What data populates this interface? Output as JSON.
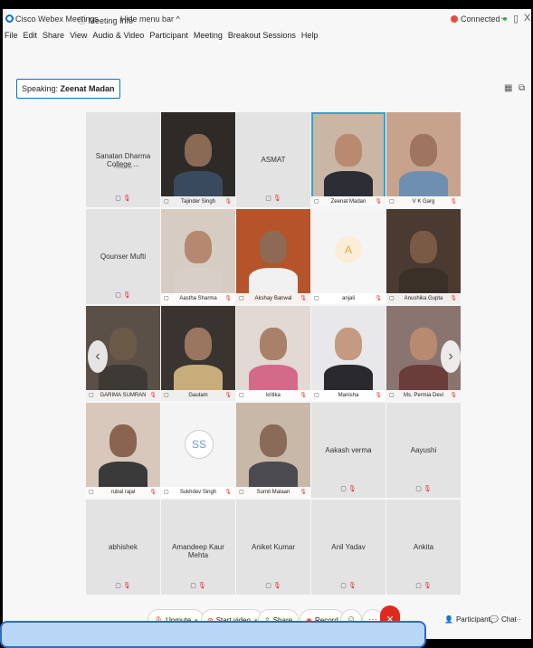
{
  "titlebar": {
    "app_name": "Cisco Webex Meetings",
    "meeting_info": "Meeting Info",
    "hide_menu": "Hide menu bar ^",
    "status": "Connected",
    "minimize": "–",
    "restore": "▯",
    "close": "X"
  },
  "menu": [
    "File",
    "Edit",
    "Share",
    "View",
    "Audio & Video",
    "Participant",
    "Meeting",
    "Breakout Sessions",
    "Help"
  ],
  "speaking": {
    "label": "Speaking:",
    "name": "Zeenat Madan"
  },
  "participants": [
    {
      "name": "Sanatan Dharma College ...",
      "sub": "Host, me",
      "type": "name"
    },
    {
      "name": "Tajinder Singh",
      "type": "video",
      "skin": "#8a6a55",
      "shirt": "#3a4a5e",
      "bg": "#2e2a28"
    },
    {
      "name": "ASMAT",
      "type": "name"
    },
    {
      "name": "Zeenat Madan",
      "type": "video",
      "skin": "#b98a70",
      "shirt": "#2d2d36",
      "bg": "#c9b6a4",
      "active": true
    },
    {
      "name": "V K Garg",
      "type": "video",
      "skin": "#a07560",
      "shirt": "#6f8fb0",
      "bg": "#c7a38e"
    },
    {
      "name": "Qounser Mufti",
      "type": "name"
    },
    {
      "name": "Aastha Sharma",
      "type": "video",
      "skin": "#b58870",
      "shirt": "#d8d0c8",
      "bg": "#d6ccc2"
    },
    {
      "name": "Akshay Banwal",
      "type": "video",
      "skin": "#8e6a55",
      "shirt": "#f0f0f0",
      "bg": "#b5532b"
    },
    {
      "name": "anjali",
      "type": "avatar",
      "initial": "A",
      "style": "a"
    },
    {
      "name": "Anushika Gupta",
      "type": "video",
      "skin": "#7a5a44",
      "shirt": "#3b3028",
      "bg": "#4a3a30"
    },
    {
      "name": "GARIMA SUMRAN",
      "type": "video",
      "skin": "#6b5a48",
      "shirt": "#3d3a36",
      "bg": "#5a5048"
    },
    {
      "name": "Gautam",
      "type": "video",
      "skin": "#9a7560",
      "shirt": "#c7ad7a",
      "bg": "#3a3430"
    },
    {
      "name": "kritika",
      "type": "video",
      "skin": "#a98068",
      "shirt": "#d46a8a",
      "bg": "#e2d8d4"
    },
    {
      "name": "Manisha",
      "type": "video",
      "skin": "#c49a80",
      "shirt": "#2a2a2e",
      "bg": "#e8e8ea"
    },
    {
      "name": "Ms. Permia Devi",
      "type": "video",
      "skin": "#b88a70",
      "shirt": "#6a3c3a",
      "bg": "#8a7470"
    },
    {
      "name": "rubal rajal",
      "type": "video",
      "skin": "#8a6450",
      "shirt": "#3a3a3a",
      "bg": "#d8c8bc"
    },
    {
      "name": "Sukhdev Singh",
      "type": "avatar",
      "initial": "SS",
      "style": "s"
    },
    {
      "name": "Sumit Malaan",
      "type": "video",
      "skin": "#8a6a58",
      "shirt": "#4a4a50",
      "bg": "#c8b8a8"
    },
    {
      "name": "Aakash verma",
      "type": "name"
    },
    {
      "name": "Aayushi",
      "type": "name"
    },
    {
      "name": "abhishek",
      "type": "name"
    },
    {
      "name": "Amandeep Kaur Mehta",
      "type": "name"
    },
    {
      "name": "Aniket Kumar",
      "type": "name"
    },
    {
      "name": "Anil Yadav",
      "type": "name"
    },
    {
      "name": "Ankita",
      "type": "name"
    }
  ],
  "nav": {
    "prev": "‹",
    "next": "›"
  },
  "toolbar": {
    "unmute": "Unmute",
    "start_video": "Start video",
    "share": "Share",
    "record": "Record",
    "participants": "Participants",
    "chat": "Chat",
    "more": "···"
  }
}
